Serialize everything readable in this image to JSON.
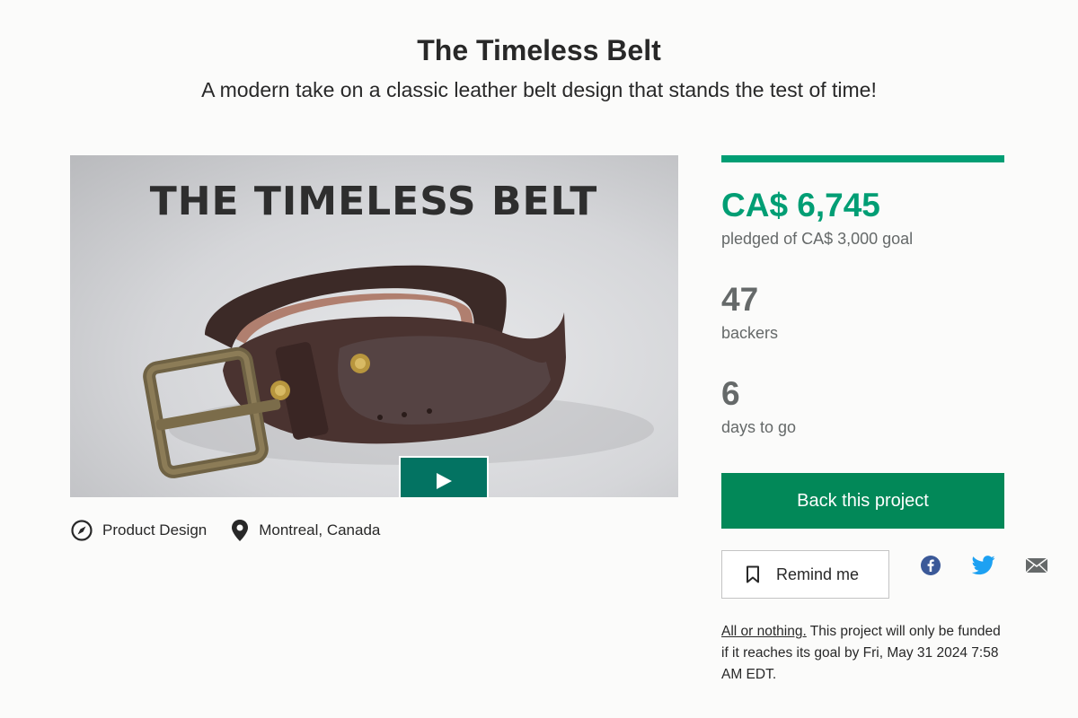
{
  "project": {
    "title": "The Timeless Belt",
    "subtitle": "A modern take on a classic leather belt design that stands the test of time!"
  },
  "video": {
    "overlay_text": "THE TIMELESS BELT",
    "play_icon": "play-icon"
  },
  "meta": {
    "category_icon": "compass-icon",
    "category": "Product Design",
    "location_icon": "map-pin-icon",
    "location": "Montreal, Canada"
  },
  "funding": {
    "progress_percent": 100,
    "pledged": "CA$ 6,745",
    "pledged_label": "pledged of CA$ 3,000 goal",
    "backers": "47",
    "backers_label": "backers",
    "days": "6",
    "days_label": "days to go"
  },
  "actions": {
    "back_label": "Back this project",
    "remind_label": "Remind me",
    "remind_icon": "bookmark-icon"
  },
  "share": {
    "facebook_icon": "facebook-icon",
    "twitter_icon": "twitter-icon",
    "email_icon": "email-icon"
  },
  "note": {
    "link_text": "All or nothing.",
    "text": " This project will only be funded if it reaches its goal by Fri, May 31 2024 7:58 AM EDT."
  },
  "colors": {
    "accent": "#009e74",
    "button": "#028858",
    "twitter": "#1da1f2",
    "facebook": "#3b5998"
  }
}
